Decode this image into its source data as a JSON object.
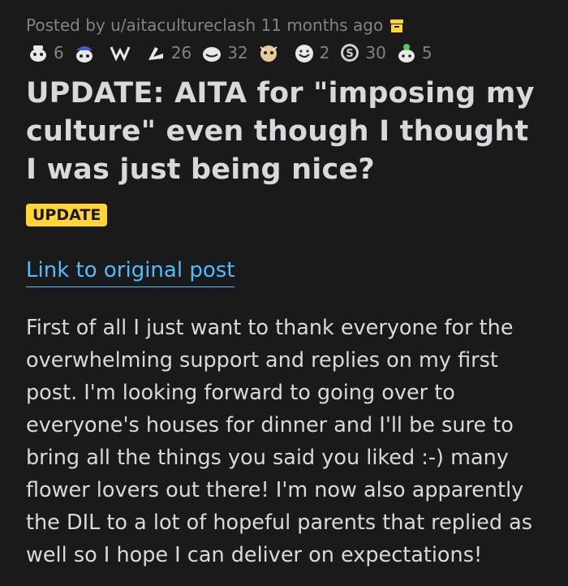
{
  "post": {
    "meta": "Posted by u/aitacultureclash 11 months ago",
    "title": "UPDATE: AITA for \"imposing my culture\" even though I thought I was just being nice?",
    "flair": "UPDATE",
    "link_text": "Link to original post",
    "body": "First of all I just want to thank everyone for the overwhelming support and replies on my first post. I'm looking forward to going over to everyone's houses for dinner and I'll be sure to bring all the things you said you liked :-) many flower lovers out there! I'm now also apparently the DIL to a lot of hopeful parents that replied as well so I hope I can deliver on expectations!"
  },
  "awards": [
    {
      "icon": "award-1-icon",
      "count": "6"
    },
    {
      "icon": "award-2-icon",
      "count": ""
    },
    {
      "icon": "award-3-icon",
      "count": ""
    },
    {
      "icon": "award-4-icon",
      "count": "26"
    },
    {
      "icon": "award-5-icon",
      "count": "32"
    },
    {
      "icon": "award-6-icon",
      "count": ""
    },
    {
      "icon": "award-7-icon",
      "count": "2"
    },
    {
      "icon": "silver-award-icon",
      "count": "30"
    },
    {
      "icon": "wholesome-award-icon",
      "count": "5"
    }
  ],
  "colors": {
    "background": "#1a1a1b",
    "text": "#d7dadc",
    "meta": "#818384",
    "flair_bg": "#ffd635",
    "link": "#4fbcff",
    "archive_icon": "#ffd635"
  }
}
